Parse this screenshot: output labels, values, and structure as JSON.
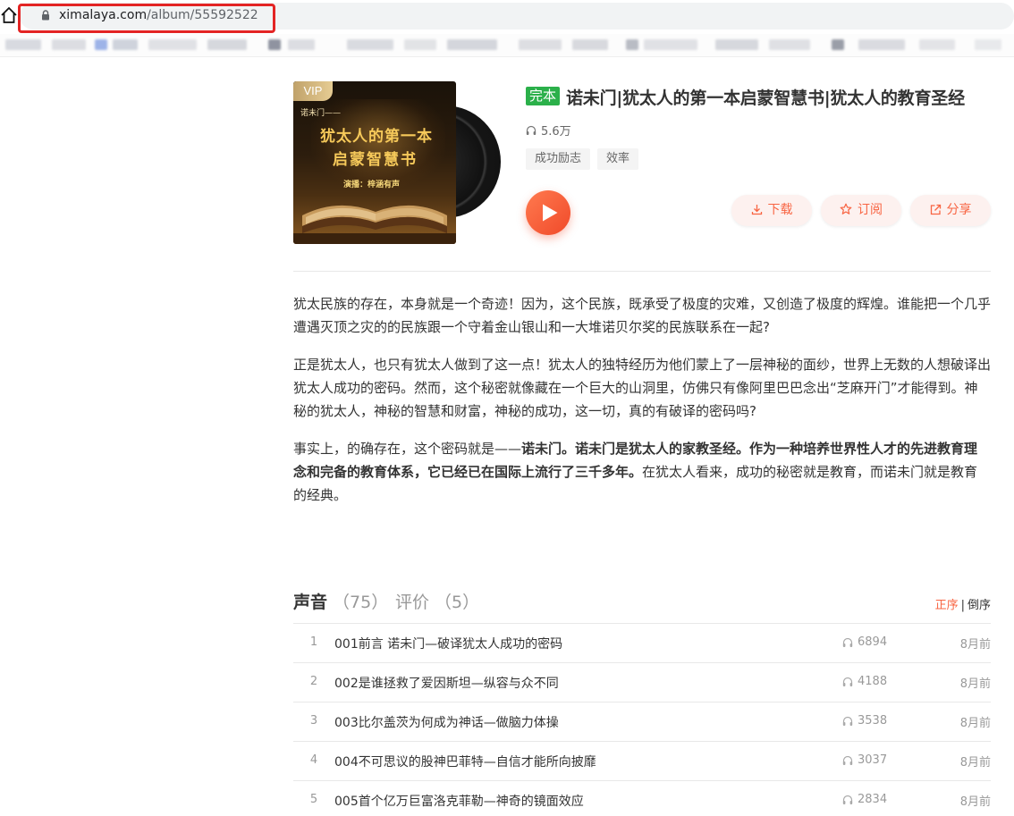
{
  "browser": {
    "url_domain": "ximalaya.com",
    "url_path": "/album/55592522"
  },
  "album": {
    "vip_label": "VIP",
    "cover": {
      "brand": "诺未门——",
      "title_line1": "犹太人的第一本",
      "title_line2": "启蒙智慧书",
      "narrator": "演播：梓涵有声"
    },
    "finished_badge": "完本",
    "title": "诺未门|犹太人的第一本启蒙智慧书|犹太人的教育圣经",
    "play_count": "5.6万",
    "tags": [
      "成功励志",
      "效率"
    ],
    "actions": {
      "download": "下载",
      "subscribe": "订阅",
      "share": "分享"
    }
  },
  "intro": {
    "p1": "犹太民族的存在，本身就是一个奇迹！因为，这个民族，既承受了极度的灾难，又创造了极度的辉煌。谁能把一个几乎遭遇灭顶之灾的的民族跟一个守着金山银山和一大堆诺贝尔奖的民族联系在一起?",
    "p2": "正是犹太人，也只有犹太人做到了这一点！犹太人的独特经历为他们蒙上了一层神秘的面纱，世界上无数的人想破译出犹太人成功的密码。然而，这个秘密就像藏在一个巨大的山洞里，仿佛只有像阿里巴巴念出“芝麻开门”才能得到。神秘的犹太人，神秘的智慧和财富，神秘的成功，这一切，真的有破译的密码吗?",
    "p3_start": "事实上，的确存在，这个密码就是——",
    "p3_bold": "诺未门。诺未门是犹太人的家教圣经。作为一种培养世界性人才的先进教育理念和完备的教育体系，它已经已在国际上流行了三千多年。",
    "p3_end": "在犹太人看来，成功的秘密就是教育，而诺未门就是教育的经典。"
  },
  "tabs": {
    "sounds_label": "声音",
    "sounds_count": "（75）",
    "reviews_label": "评价",
    "reviews_count": "（5）"
  },
  "sort": {
    "asc": "正序",
    "separator": "|",
    "desc": "倒序"
  },
  "tracks": [
    {
      "num": "1",
      "title": "001前言 诺未门—破译犹太人成功的密码",
      "plays": "6894",
      "date": "8月前"
    },
    {
      "num": "2",
      "title": "002是谁拯救了爱因斯坦—纵容与众不同",
      "plays": "4188",
      "date": "8月前"
    },
    {
      "num": "3",
      "title": "003比尔盖茨为何成为神话—做脑力体操",
      "plays": "3538",
      "date": "8月前"
    },
    {
      "num": "4",
      "title": "004不可思议的股神巴菲特—自信才能所向披靡",
      "plays": "3037",
      "date": "8月前"
    },
    {
      "num": "5",
      "title": "005首个亿万巨富洛克菲勒—神奇的镜面效应",
      "plays": "2834",
      "date": "8月前"
    }
  ],
  "colors": {
    "accent": "#f86442",
    "finished_badge": "#2bb04a",
    "highlight_box": "#e32424"
  }
}
